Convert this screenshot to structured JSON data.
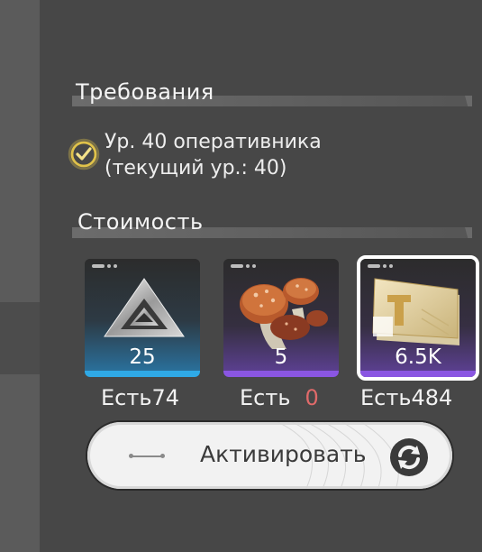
{
  "requirements": {
    "title": "Требования",
    "text_line1": "Ур. 40 оперативника",
    "text_line2": "(текущий ур.: 40)",
    "icon": "check-circle-icon"
  },
  "cost": {
    "title": "Стоимость",
    "items": [
      {
        "name": "silver-prism",
        "quantity": "25",
        "owned_label": "Есть74",
        "owned_value": "",
        "rarity_color": "#2fa9e6",
        "icon": "prism-icon"
      },
      {
        "name": "mushrooms",
        "quantity": "5",
        "owned_label": "Есть",
        "owned_value": "0",
        "rarity_color": "#8a56e2",
        "icon": "mushroom-icon"
      },
      {
        "name": "currency-notes",
        "quantity": "6.5K",
        "owned_label": "Есть484",
        "owned_value": "",
        "rarity_color": "#8a56e2",
        "icon": "banknote-icon"
      }
    ]
  },
  "activate_button": {
    "label": "Активировать",
    "icon": "refresh-icon"
  },
  "colors": {
    "background": "#474747",
    "button": "#f2f2f2",
    "check_icon": "#e0c24a",
    "zero_highlight": "#e06a6a"
  }
}
